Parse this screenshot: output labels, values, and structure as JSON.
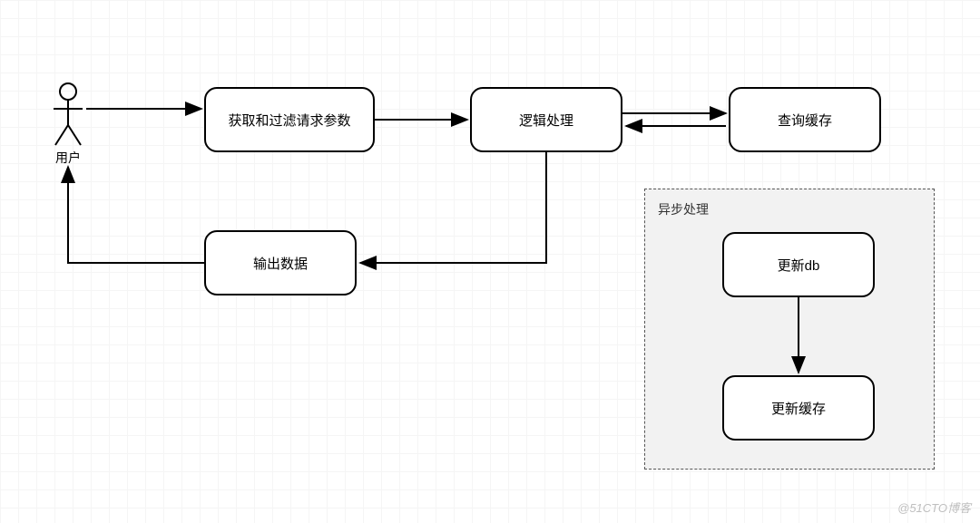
{
  "diagram": {
    "actor_label": "用户",
    "nodes": {
      "filter_params": "获取和过滤请求参数",
      "logic": "逻辑处理",
      "query_cache": "查询缓存",
      "output_data": "输出数据",
      "update_db": "更新db",
      "update_cache": "更新缓存"
    },
    "group": {
      "async_label": "异步处理"
    },
    "watermark": "@51CTO博客"
  }
}
